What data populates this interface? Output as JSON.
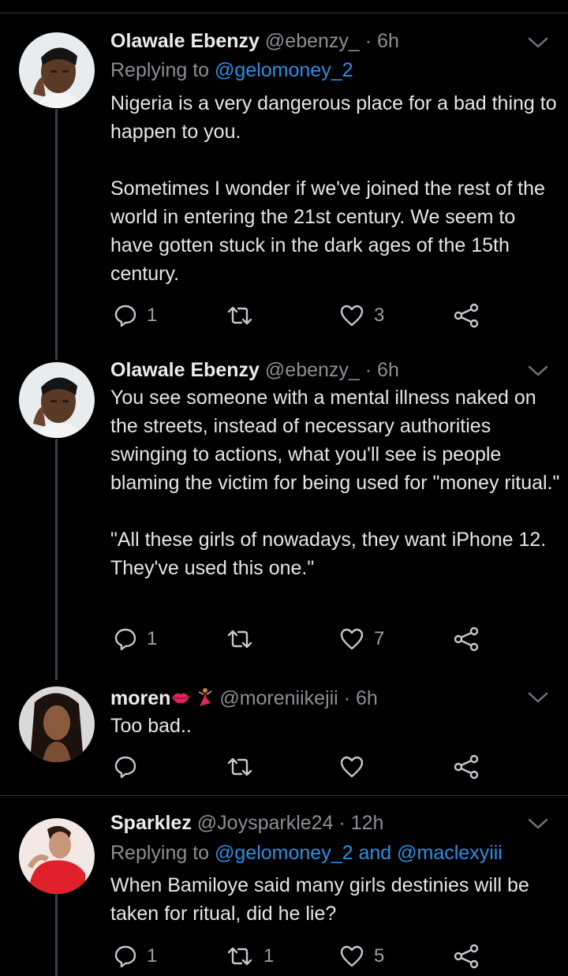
{
  "tweets": [
    {
      "name": "Olawale Ebenzy",
      "handle": "@ebenzy_",
      "time": "· 6h",
      "replying_label": "Replying to",
      "replying_mentions": "@gelomoney_2",
      "paragraphs": [
        "Nigeria is a very dangerous place for a bad thing to happen to you.",
        "Sometimes I wonder if we've joined the rest of the world in entering the 21st century. We seem to have gotten stuck in the dark ages of the 15th century."
      ],
      "replies": "1",
      "retweets": "",
      "likes": "3",
      "avatar_icon": "profile-photo-man"
    },
    {
      "name": "Olawale Ebenzy",
      "handle": "@ebenzy_",
      "time": "· 6h",
      "paragraphs": [
        "You see someone with a mental illness naked on the streets, instead of necessary authorities swinging to actions, what you'll see is people blaming the victim for being used for \"money ritual.\"",
        "\"All these girls of nowadays, they want iPhone 12. They've used this one.\""
      ],
      "replies": "1",
      "retweets": "",
      "likes": "7",
      "avatar_icon": "profile-photo-man"
    },
    {
      "name": "moren",
      "name_emojis": [
        "lips-emoji",
        "dancer-emoji"
      ],
      "handle": "@moreniikejii",
      "time": "· 6h",
      "paragraphs": [
        "Too bad.."
      ],
      "replies": "",
      "retweets": "",
      "likes": "",
      "avatar_icon": "profile-photo-woman"
    },
    {
      "name": "Sparklez",
      "handle": "@Joysparkle24",
      "time": "· 12h",
      "replying_label": "Replying to",
      "replying_mentions": "@gelomoney_2 and @maclexyiii",
      "paragraphs": [
        "When Bamiloye said many girls destinies will be taken for ritual, did he lie?"
      ],
      "replies": "1",
      "retweets": "1",
      "likes": "5",
      "avatar_icon": "profile-photo-woman-red"
    }
  ],
  "colors": {
    "background": "#000000",
    "text": "#e6e6e6",
    "secondary": "#8b8f94",
    "link": "#2a8fe5",
    "divider": "#2f3336"
  }
}
